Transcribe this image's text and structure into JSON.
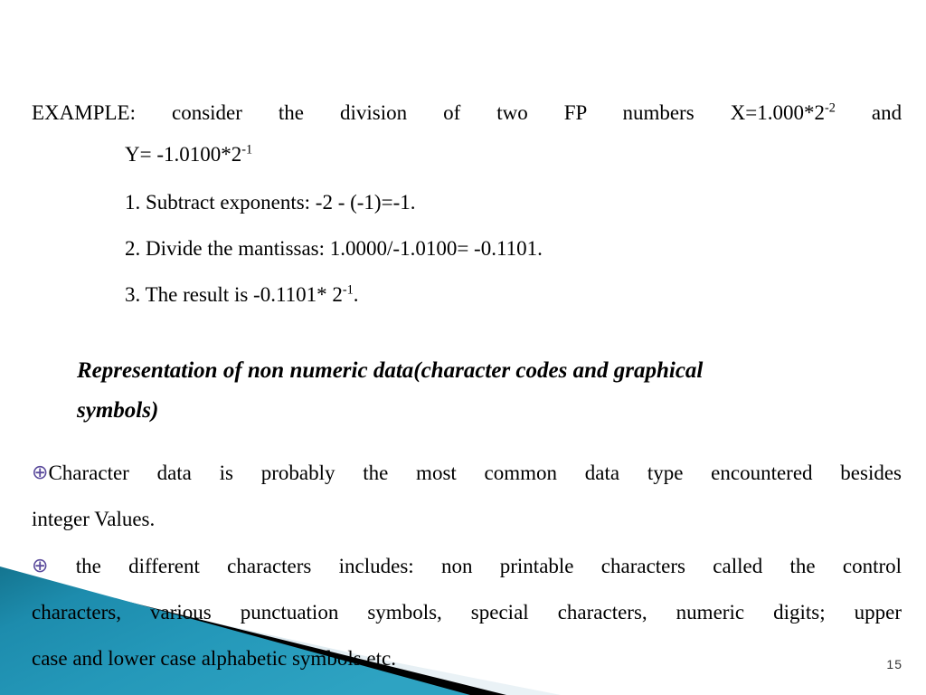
{
  "slide": {
    "page_number": "15",
    "bullet_glyph": "⊕",
    "bullet_color": "#5b4b9c",
    "background_color": "#ffffff",
    "text_color": "#000000"
  },
  "example": {
    "label": "EXAMPLE:",
    "words": [
      "consider",
      "the",
      "division",
      "of",
      "two",
      "FP",
      "numbers",
      "X=1.000*2",
      "and"
    ],
    "x_exponent": "-2",
    "full_text": "EXAMPLE: consider the division of two FP numbers X=1.000*2-2 and",
    "y_line": {
      "base": "Y= -1.0100*2",
      "exponent": "-1",
      "full_text": "Y= -1.0100*2-1"
    }
  },
  "steps": [
    {
      "text": "1. Subtract exponents:  -2 - (-1)=-1."
    },
    {
      "text": "2. Divide the mantissas: 1.0000/-1.0100= -0.1101."
    },
    {
      "prefix": "3. The result is  -0.1101* 2",
      "exponent": "-1",
      "suffix": ".",
      "text": "3. The result is  -0.1101* 2-1."
    }
  ],
  "heading": {
    "line1": "Representation of non numeric data(character codes and graphical",
    "line2": "symbols)",
    "full_text": "Representation of non numeric data(character codes and graphical symbols)"
  },
  "paragraphs": [
    {
      "id": "character-data",
      "line1": "Character data is probably the most common data type encountered besides",
      "line2": "integer Values.",
      "full_text": "Character data is probably the most common data type encountered besides integer Values."
    },
    {
      "id": "different-characters",
      "line1": "the different characters includes: non printable characters called the control",
      "line2": "characters, various punctuation symbols, special characters, numeric digits; upper",
      "line3": "case  and lower case alphabetic symbols etc.",
      "full_text": "the different characters includes: non printable characters called the control characters, various punctuation symbols, special characters, numeric digits; upper case and lower case alphabetic symbols etc."
    }
  ],
  "decoration": {
    "teal_color": "#1f93b5",
    "teal_dark": "#14758f",
    "black_color": "#000000",
    "pale_color": "#d7e5ec"
  }
}
